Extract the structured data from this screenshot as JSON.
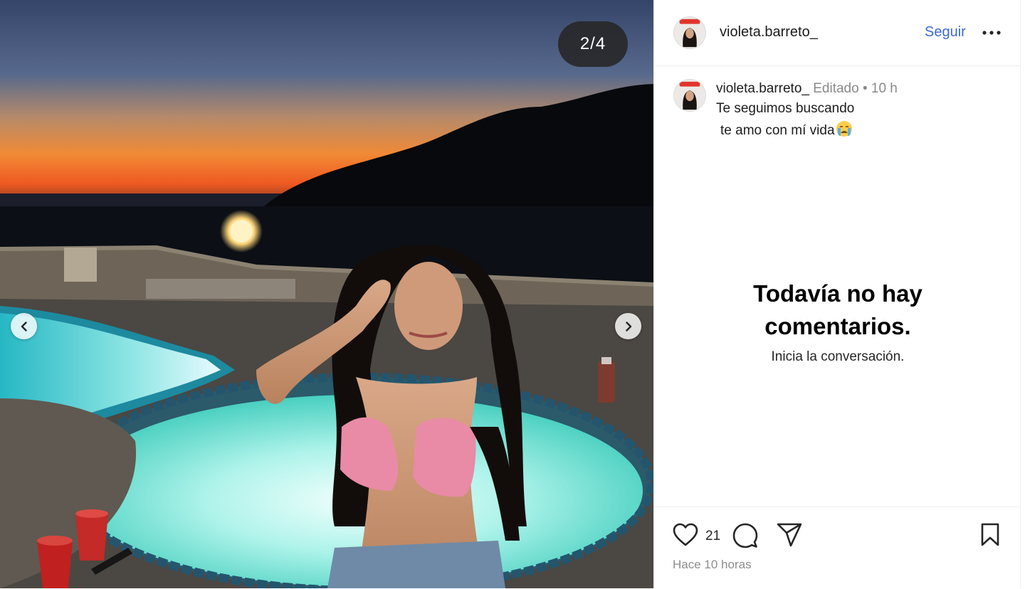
{
  "post": {
    "counter": "2/4",
    "username": "violeta.barreto_",
    "follow_label": "Seguir",
    "caption": {
      "username": "violeta.barreto_",
      "meta": " Editado • 10 h",
      "line1": "Te seguimos buscando",
      "line2": "te amo con mí vida"
    },
    "empty_comments": {
      "title": "Todavía no hay comentarios.",
      "subtitle": "Inicia la conversación."
    },
    "likes": "21",
    "time_ago": "Hace 10 horas"
  },
  "icons": {
    "prev": "chevron-left-icon",
    "next": "chevron-right-icon",
    "more": "more-dots-icon",
    "like": "heart-icon",
    "comment": "comment-icon",
    "share": "send-icon",
    "save": "bookmark-icon",
    "emoji": "crying-face-emoji"
  },
  "colors": {
    "follow": "#3b6bd6",
    "muted": "#8e8e8e",
    "counter_bg": "#262626"
  }
}
